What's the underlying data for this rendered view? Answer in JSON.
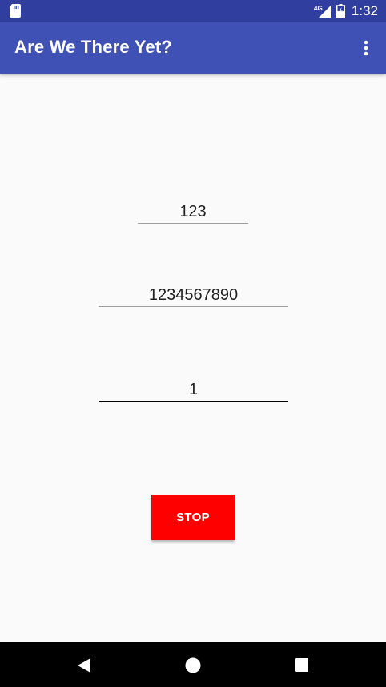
{
  "status_bar": {
    "time": "1:32",
    "network_label": "4G",
    "icons": [
      "sd-card-icon",
      "network-signal-icon",
      "battery-icon"
    ]
  },
  "app_bar": {
    "title": "Are We There Yet?",
    "overflow_icon": "more-vert-icon"
  },
  "fields": [
    {
      "value": "123"
    },
    {
      "value": "1234567890"
    },
    {
      "value": "1"
    }
  ],
  "stop_button": {
    "label": "STOP"
  },
  "nav_bar": {
    "icons": [
      "back-icon",
      "home-icon",
      "recents-icon"
    ]
  },
  "colors": {
    "status_bar": "#303f9f",
    "app_bar": "#3f51b5",
    "background": "#fafafa",
    "stop_button": "#ff0000",
    "nav_bar": "#000000"
  }
}
